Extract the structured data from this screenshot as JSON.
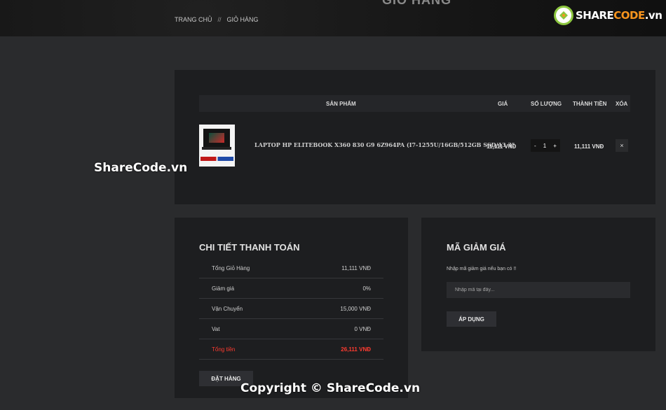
{
  "hero": {
    "title": "GIỎ HÀNG"
  },
  "breadcrumb": {
    "home": "TRANG CHỦ",
    "separator": "//",
    "current": "GIỎ HÀNG"
  },
  "logo": {
    "text_main": "SHARE",
    "text_accent": "CODE",
    "text_suffix": ".vn"
  },
  "cart": {
    "headers": {
      "product": "SẢN PHẨM",
      "price": "GIÁ",
      "quantity": "SỐ LƯỢNG",
      "subtotal": "THÀNH TIỀN",
      "remove": "XÓA"
    },
    "items": [
      {
        "name": "LAPTOP HP ELITEBOOK X360 830 G9 6Z964PA (I7-1255U/16GB/512GB SSD/13.3\"",
        "price": "11,111 VNĐ",
        "quantity": "1",
        "minus": "-",
        "plus": "+",
        "subtotal": "11,111 VNĐ",
        "remove_icon": "×"
      }
    ]
  },
  "checkout": {
    "title": "CHI TIẾT THANH TOÁN",
    "rows": [
      {
        "label": "Tổng Giỏ Hàng",
        "value": "11,111 VNĐ"
      },
      {
        "label": "Giảm giá",
        "value": "0%"
      },
      {
        "label": "Vận Chuyển",
        "value": "15,000 VNĐ"
      },
      {
        "label": "Vat",
        "value": "0 VNĐ"
      },
      {
        "label": "Tổng tiền",
        "value": "26,111 VNĐ"
      }
    ],
    "order_button": "ĐẶT HÀNG",
    "total_color": "#ff3b30"
  },
  "coupon": {
    "title": "MÃ GIẢM GIÁ",
    "hint": "Nhập mã giảm giá nếu bạn có !!",
    "placeholder": "Nhập mã tại đây...",
    "apply_button": "ÁP DỤNG"
  },
  "watermarks": {
    "side": "ShareCode.vn",
    "footer": "Copyright © ShareCode.vn"
  }
}
